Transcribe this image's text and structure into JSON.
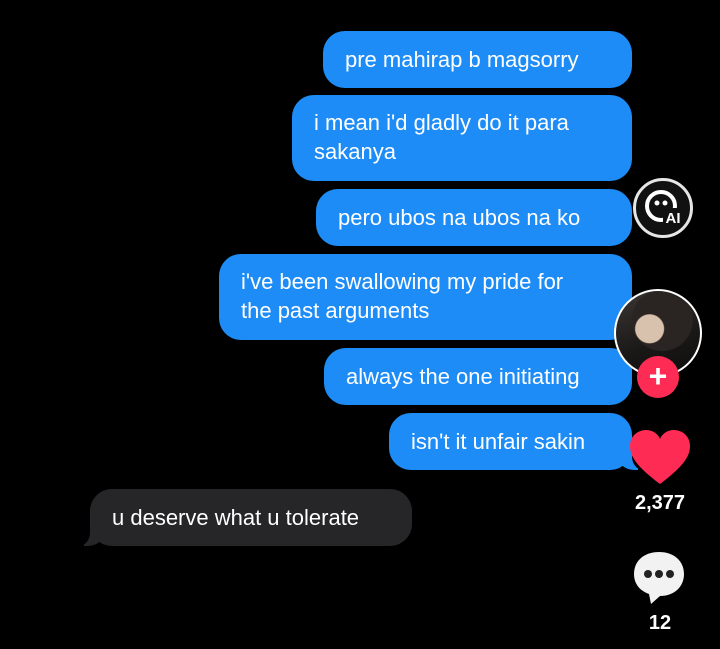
{
  "messages": {
    "m1": "pre mahirap b magsorry",
    "m2_line1": "i mean i'd gladly do it para",
    "m2_line2": "sakanya",
    "m3": "pero ubos na ubos na ko",
    "m4_line1": "i've been swallowing my pride for",
    "m4_line2": "the past arguments",
    "m5": "always the one initiating",
    "m6": "isn't it unfair sakin",
    "reply": "u deserve what u tolerate"
  },
  "sidebar": {
    "ai_badge_label": "AI",
    "follow_symbol": "+",
    "like_count": "2,377",
    "comment_count": "12"
  },
  "colors": {
    "sent_bubble": "#1e8cf7",
    "received_bubble": "#262628",
    "like_heart": "#fe2c55",
    "follow": "#fe2c55"
  },
  "icons": [
    "ai-label-icon",
    "avatar",
    "plus-icon",
    "heart-icon",
    "comment-icon"
  ]
}
